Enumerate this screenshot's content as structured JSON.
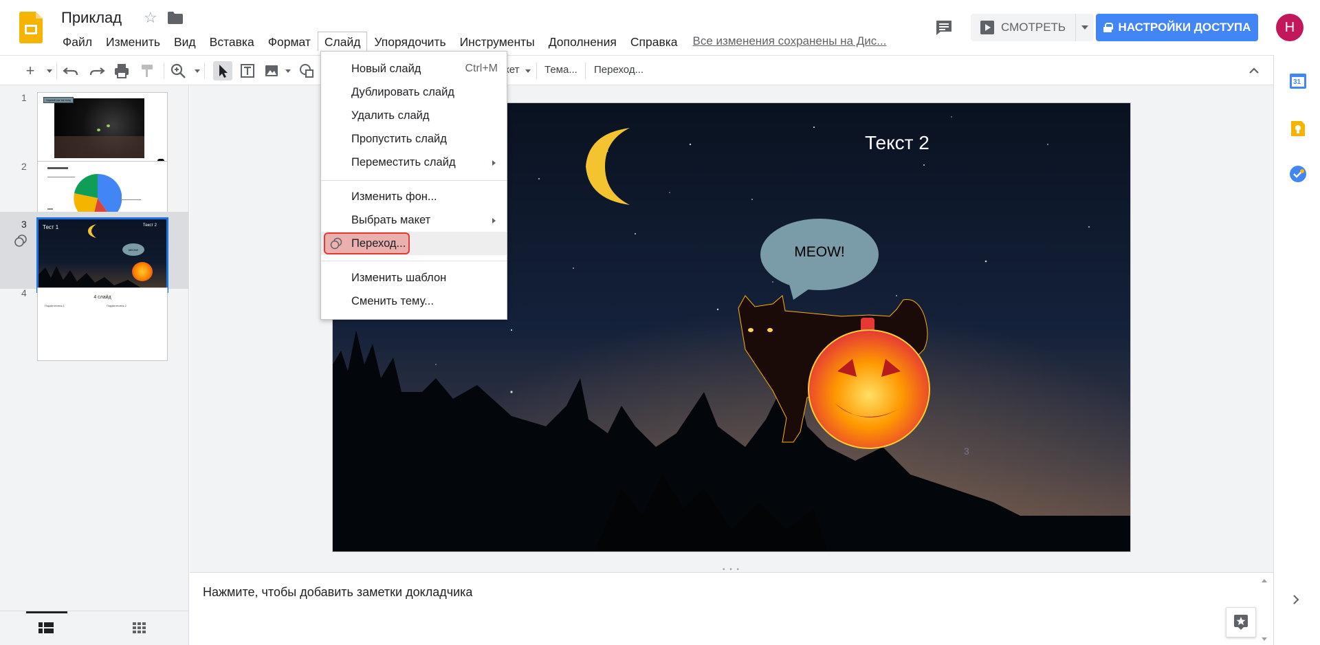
{
  "app": {
    "title": "Приклад",
    "save_status": "Все изменения сохранены на Дис..."
  },
  "menu": [
    "Файл",
    "Изменить",
    "Вид",
    "Вставка",
    "Формат",
    "Слайд",
    "Упорядочить",
    "Инструменты",
    "Дополнения",
    "Справка"
  ],
  "header": {
    "present_label": "СМОТРЕТЬ",
    "share_label": "НАСТРОЙКИ ДОСТУПА",
    "avatar_letter": "Н"
  },
  "toolbar": {
    "layout_partial": "кет",
    "theme_label": "Тема...",
    "transition_label": "Переход..."
  },
  "slides": [
    {
      "num": "1",
      "caption": "Чорний кот на полу"
    },
    {
      "num": "2",
      "caption": ""
    },
    {
      "num": "3",
      "caption": "Тест 1",
      "caption2": "Текст 2",
      "bubble": "MEOW!"
    },
    {
      "num": "4",
      "caption": "4 слайд",
      "sub1": "Подзаголовок 1",
      "sub2": "Подзаголовок 2"
    }
  ],
  "current_slide": {
    "text2": "Текст 2",
    "bubble": "MEOW!",
    "page_number": "3"
  },
  "notes_placeholder": "Нажмите, чтобы добавить заметки докладчика",
  "slide_menu": {
    "items": [
      {
        "label": "Новый слайд",
        "shortcut": "Ctrl+M"
      },
      {
        "label": "Дублировать слайд"
      },
      {
        "label": "Удалить слайд"
      },
      {
        "label": "Пропустить слайд"
      },
      {
        "label": "Переместить слайд",
        "submenu": true
      },
      {
        "label": "Изменить фон..."
      },
      {
        "label": "Выбрать макет",
        "submenu": true
      },
      {
        "label": "Переход..."
      },
      {
        "label": "Изменить шаблон"
      },
      {
        "label": "Сменить тему..."
      }
    ]
  },
  "side_panel": {
    "calendar_day": "31"
  },
  "colors": {
    "accent": "#4285f4",
    "selection": "#1a73e8",
    "avatar": "#c2185b",
    "highlight_ring": "#e53935",
    "slides_logo": "#f4b400"
  }
}
